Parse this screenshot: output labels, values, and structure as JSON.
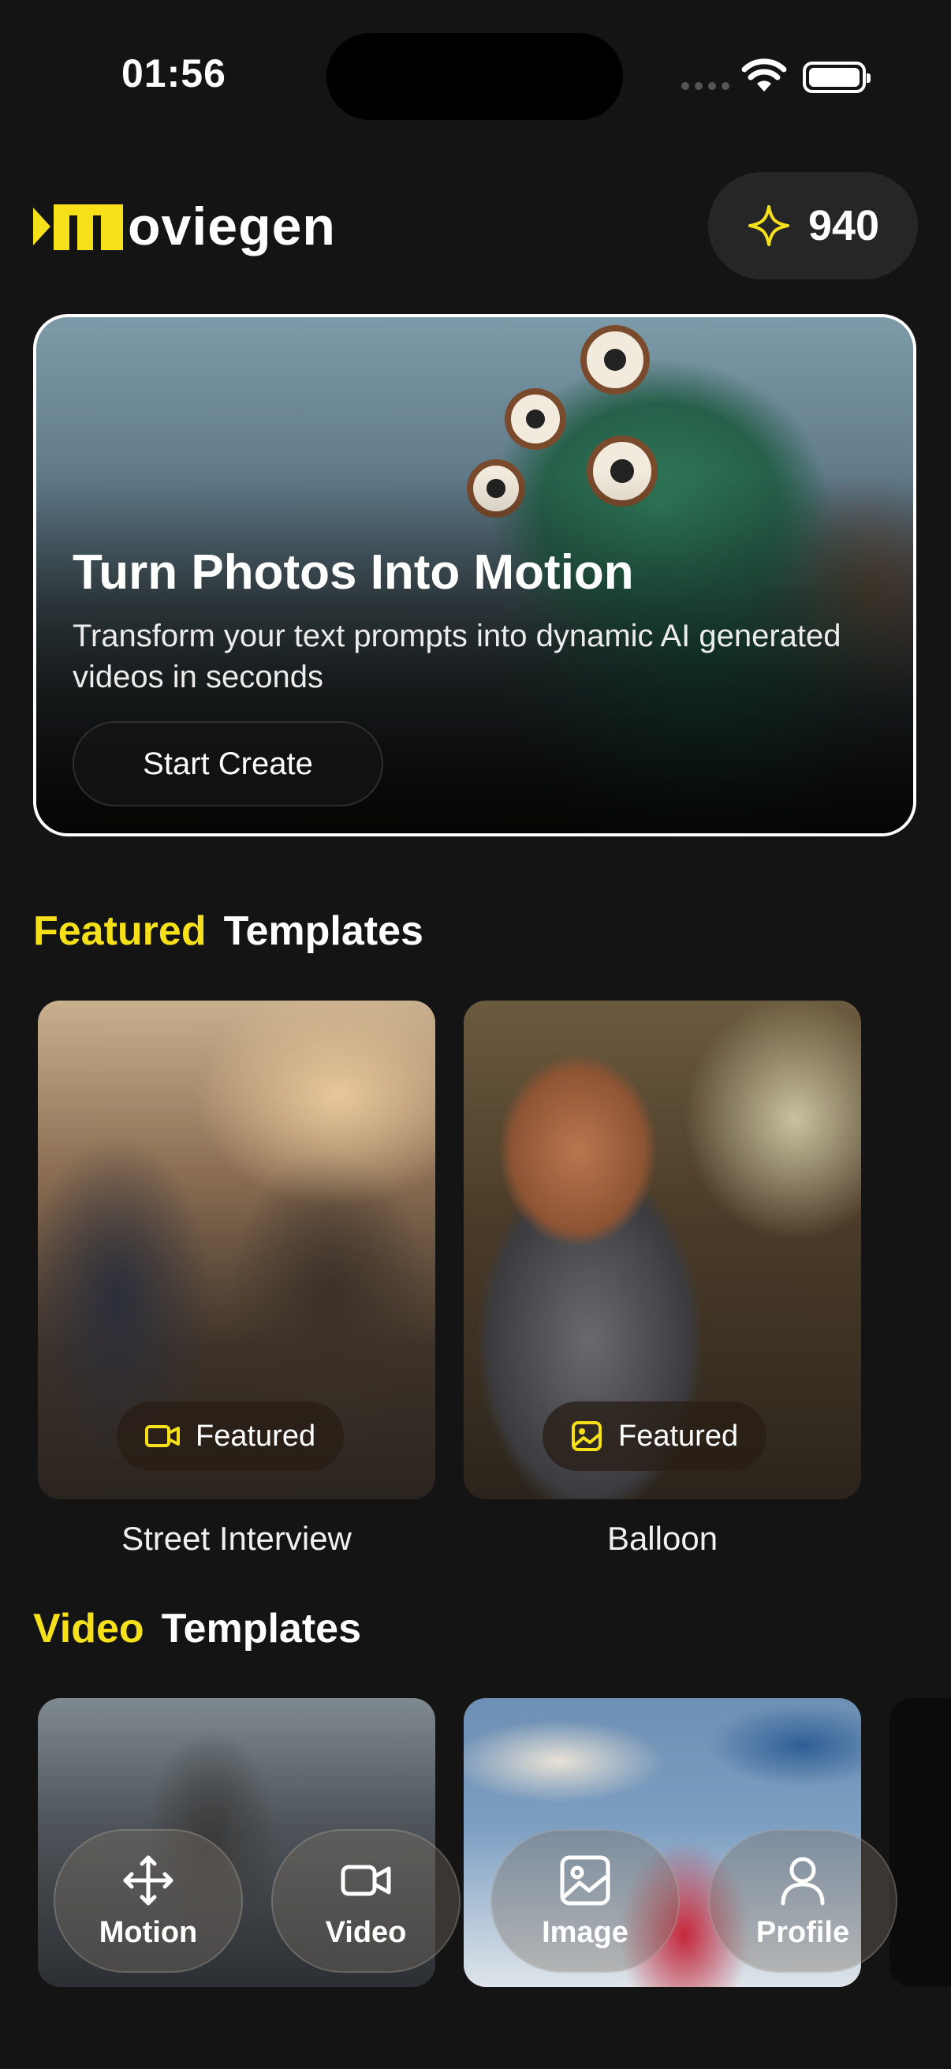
{
  "status": {
    "time": "01:56"
  },
  "header": {
    "logo_text": "oviegen",
    "credits": "940"
  },
  "hero": {
    "title": "Turn Photos Into Motion",
    "subtitle": "Transform your text prompts into dynamic AI generated videos in seconds",
    "button": "Start Create"
  },
  "featured": {
    "accent": "Featured",
    "title": "Templates",
    "cards": [
      {
        "badge": "Featured",
        "badge_icon": "video-camera-icon",
        "label": "Street Interview"
      },
      {
        "badge": "Featured",
        "badge_icon": "image-icon",
        "label": "Balloon"
      }
    ]
  },
  "video": {
    "accent": "Video",
    "title": "Templates"
  },
  "nav": [
    {
      "label": "Motion",
      "icon": "move-arrows-icon"
    },
    {
      "label": "Video",
      "icon": "video-camera-icon"
    },
    {
      "label": "Image",
      "icon": "image-icon"
    },
    {
      "label": "Profile",
      "icon": "user-icon"
    }
  ],
  "colors": {
    "accent": "#f5e01a",
    "background": "#141414"
  }
}
